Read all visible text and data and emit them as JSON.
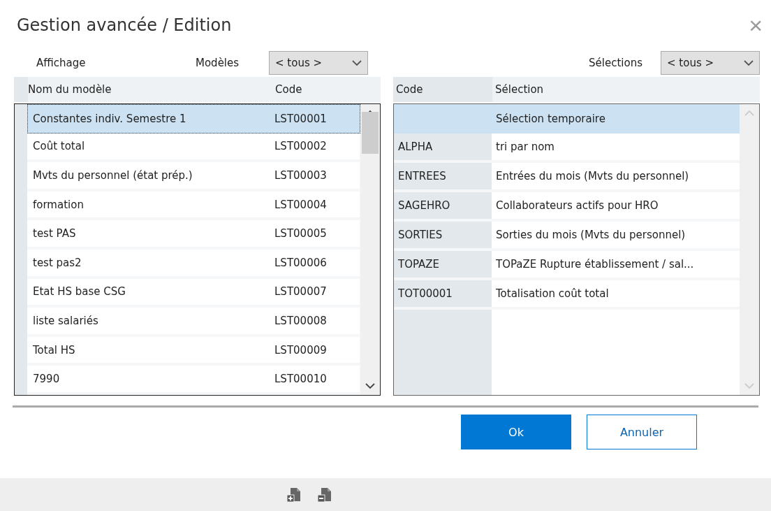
{
  "window": {
    "title": "Gestion avancée / Edition",
    "close": "×"
  },
  "affichage": "Affichage",
  "models_filter": {
    "label": "Modèles",
    "value": "< tous >"
  },
  "selections_filter": {
    "label": "Sélections",
    "value": "< tous >"
  },
  "models": {
    "columns": [
      "Nom du modèle",
      "Code"
    ],
    "rows": [
      {
        "name": "Constantes indiv. Semestre 1",
        "code": "LST00001",
        "selected": true
      },
      {
        "name": "Coût total",
        "code": "LST00002",
        "selected": false
      },
      {
        "name": "Mvts du personnel (état prép.)",
        "code": "LST00003",
        "selected": false
      },
      {
        "name": "formation",
        "code": "LST00004",
        "selected": false
      },
      {
        "name": "test PAS",
        "code": "LST00005",
        "selected": false
      },
      {
        "name": "test pas2",
        "code": "LST00006",
        "selected": false
      },
      {
        "name": "Etat HS base CSG",
        "code": "LST00007",
        "selected": false
      },
      {
        "name": "liste salariés",
        "code": "LST00008",
        "selected": false
      },
      {
        "name": "Total HS",
        "code": "LST00009",
        "selected": false
      },
      {
        "name": "7990",
        "code": "LST00010",
        "selected": false
      }
    ]
  },
  "selections": {
    "columns": [
      "Code",
      "Sélection"
    ],
    "rows": [
      {
        "code": "",
        "name": "Sélection temporaire",
        "selected": true
      },
      {
        "code": "ALPHA",
        "name": "tri par nom",
        "selected": false
      },
      {
        "code": "ENTREES",
        "name": "Entrées du mois (Mvts du personnel)",
        "selected": false
      },
      {
        "code": "SAGEHRO",
        "name": "Collaborateurs actifs pour HRO",
        "selected": false
      },
      {
        "code": "SORTIES",
        "name": "Sorties du mois (Mvts du personnel)",
        "selected": false
      },
      {
        "code": "TOPAZE",
        "name": "TOPaZE Rupture établissement / sal...",
        "selected": false
      },
      {
        "code": "TOT00001",
        "name": "Totalisation coût total",
        "selected": false
      }
    ]
  },
  "buttons": [
    {
      "label": "Ok",
      "kind": "primary"
    },
    {
      "label": "Annuler",
      "kind": "secondary"
    }
  ]
}
